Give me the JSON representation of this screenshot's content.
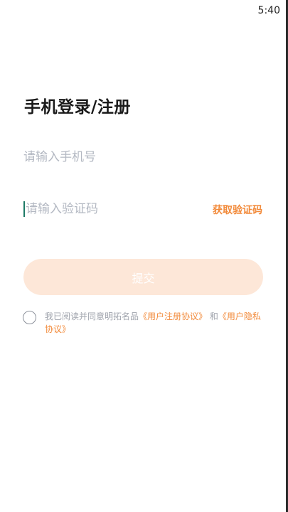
{
  "status_bar": {
    "time": "5:40"
  },
  "login": {
    "title": "手机登录/注册",
    "phone_placeholder": "请输入手机号",
    "code_placeholder": "请输入验证码",
    "get_code_label": "获取验证码",
    "submit_label": "提交"
  },
  "agreement": {
    "prefix": "我已阅读并同意明拓名品",
    "user_agreement": "《用户注册协议》",
    "conjunction": "和",
    "privacy_agreement": "《用户隐私协议》"
  },
  "colors": {
    "accent": "#f28a3a",
    "submit_disabled_bg": "#fde7d8",
    "placeholder": "#b3b8c2"
  }
}
